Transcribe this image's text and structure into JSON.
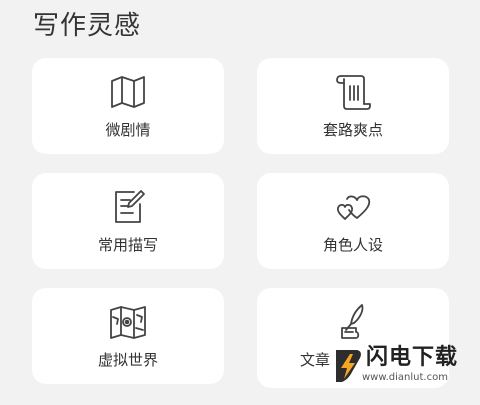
{
  "section": {
    "title": "写作灵感"
  },
  "cards": [
    {
      "label": "微剧情",
      "icon": "map-icon"
    },
    {
      "label": "套路爽点",
      "icon": "scroll-icon"
    },
    {
      "label": "常用描写",
      "icon": "note-edit-icon"
    },
    {
      "label": "角色人设",
      "icon": "hearts-icon"
    },
    {
      "label": "虚拟世界",
      "icon": "world-map-icon"
    },
    {
      "label": "文章",
      "icon": "quill-ink-icon"
    }
  ],
  "watermark": {
    "title": "闪电下载",
    "url": "www.dianlut.com",
    "accent_color": "#f5a623"
  },
  "colors": {
    "background": "#f2f2f2",
    "card": "#ffffff",
    "text": "#333333",
    "icon_stroke": "#444444"
  }
}
